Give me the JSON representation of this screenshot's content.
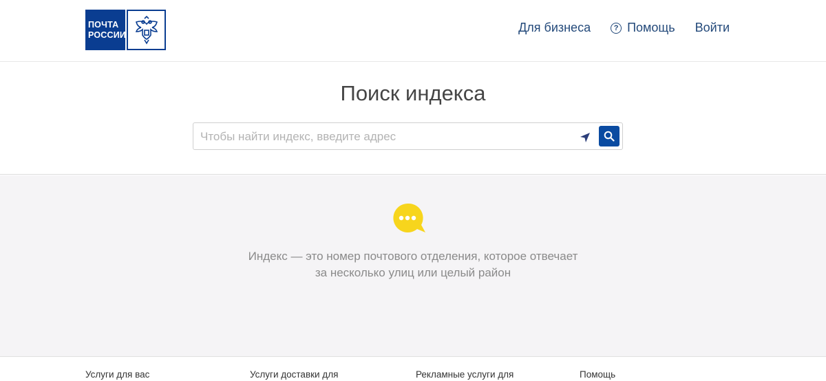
{
  "header": {
    "logo": {
      "line1": "ПОЧТА",
      "line2": "РОССИИ",
      "emblem": "double-headed-eagle-icon"
    },
    "nav": {
      "business": "Для бизнеса",
      "help_icon": "?",
      "help": "Помощь",
      "login": "Войти"
    }
  },
  "search": {
    "title": "Поиск индекса",
    "value": "",
    "placeholder": "Чтобы найти индекс, введите адрес",
    "geo_icon": "location-arrow-icon",
    "search_icon": "magnifier-icon"
  },
  "info": {
    "icon": "chat-bubble-icon",
    "line1": "Индекс — это номер почтового отделения, которое отвечает",
    "line2": "за несколько улиц или целый район"
  },
  "footer": {
    "items": [
      "Услуги для вас",
      "Услуги доставки для",
      "Рекламные услуги для",
      "Помощь"
    ]
  },
  "colors": {
    "brand_blue": "#0a3d91",
    "nav_text": "#23497a",
    "accent_yellow": "#f7d51d",
    "info_background": "#f5f4f6"
  }
}
